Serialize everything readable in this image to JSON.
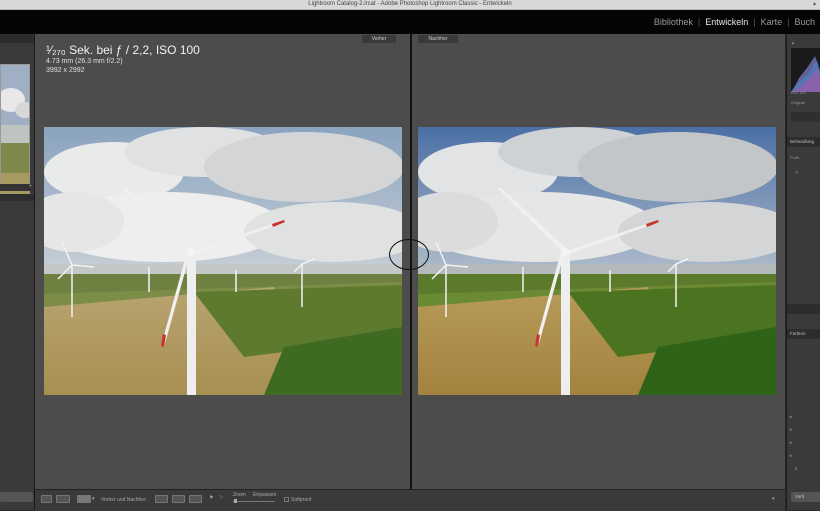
{
  "window": {
    "title": "Lightroom Catalog-2.lrcat - Adobe Photoshop Lightroom Classic - Entwickeln"
  },
  "modules": [
    {
      "label": "Bibliothek",
      "active": false
    },
    {
      "label": "Entwickeln",
      "active": true
    },
    {
      "label": "Karte",
      "active": false
    },
    {
      "label": "Buch",
      "active": false
    }
  ],
  "compare": {
    "before_label": "Vorher",
    "after_label": "Nachher"
  },
  "exif": {
    "exposure": "¹⁄₂₇₀ Sek. bei ƒ / 2,2, ISO 100",
    "focal": "4.73 mm (26.3 mm f/2.2)",
    "dimensions": "3992 x 2992"
  },
  "toolbar": {
    "before_after_label": "Vorher und Nachher:",
    "zoom_label": "Zoom",
    "zoom_fit": "Einpassen",
    "softproof_label": "Softproof"
  },
  "right_panel": {
    "original_label": "Original",
    "behandlung_label": "Behandlung",
    "profil_label": "Profil",
    "farbton_label": "Farbton",
    "bottom_button": "Vorh",
    "histogram_info": "ISO 100"
  },
  "colors": {
    "accent_text": "#e8e8e8",
    "panel_bg": "#3a3a3a",
    "canvas_bg": "#4c4c4c"
  }
}
